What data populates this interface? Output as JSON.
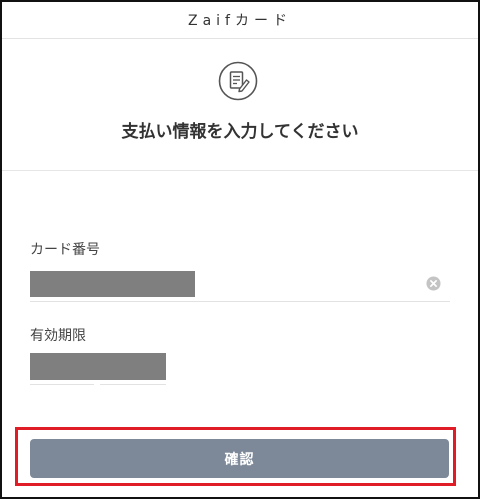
{
  "header": {
    "title": "Zaifカード"
  },
  "hero": {
    "icon": "document-edit-icon",
    "title": "支払い情報を入力してください"
  },
  "form": {
    "card_number_label": "カード番号",
    "card_number_value": "",
    "expiry_label": "有効期限",
    "expiry_value": "",
    "clear_icon": "clear-circle-icon"
  },
  "actions": {
    "confirm_label": "確認"
  },
  "colors": {
    "button": "#7d8999",
    "highlight": "#e01c26",
    "mask": "#7f7f7f"
  }
}
